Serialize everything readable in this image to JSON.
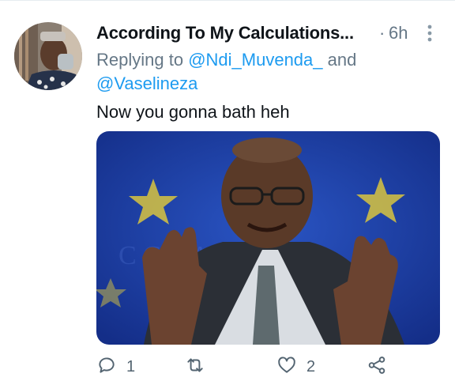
{
  "tweet": {
    "display_name": "According To My Calculations...",
    "separator": "·",
    "time": "6h",
    "reply_prefix": "Replying to ",
    "reply_user1": "@Ndi_Muvenda_",
    "reply_and": " and",
    "reply_user2": "@Vaselineza",
    "text": "Now you gonna bath heh"
  },
  "actions": {
    "reply_count": "1",
    "retweet_count": "",
    "like_count": "2"
  },
  "colors": {
    "link": "#1d9bf0",
    "muted": "#657786",
    "media_background": "#1f3d9a",
    "star": "#e9c235"
  },
  "icons": [
    "reply-icon",
    "retweet-icon",
    "like-icon",
    "share-icon",
    "more-options-icon"
  ]
}
